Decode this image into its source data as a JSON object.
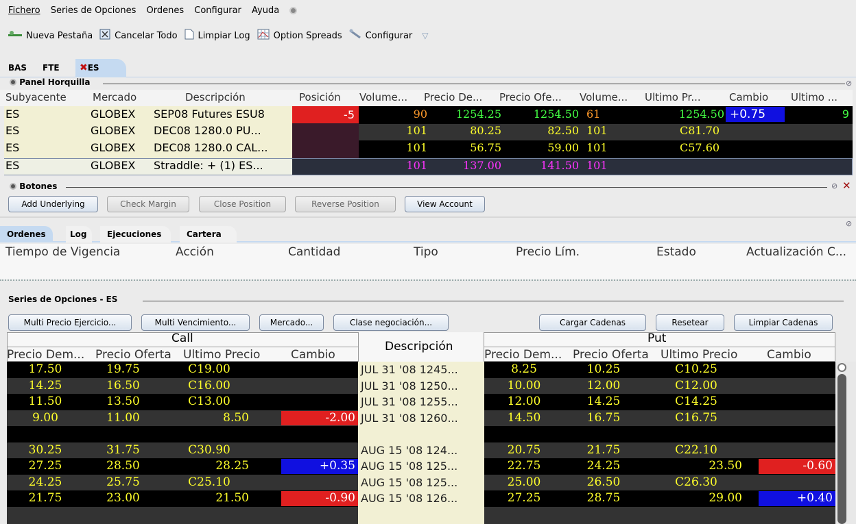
{
  "menu": [
    "Fichero",
    "Series de Opciones",
    "Ordenes",
    "Configurar",
    "Ayuda"
  ],
  "toolbar": {
    "new_tab": "Nueva Pestaña",
    "cancel_all": "Cancelar Todo",
    "clear_log": "Limpiar Log",
    "option_spreads": "Option Spreads",
    "configure": "Configurar"
  },
  "top_tabs": [
    "BAS",
    "FTE",
    "ES"
  ],
  "panel": {
    "title": "Panel Horquilla",
    "headers": [
      "Subyacente",
      "Mercado",
      "Descripción",
      "Posición",
      "Volume...",
      "Precio De...",
      "Precio Ofe...",
      "Volume...",
      "Ultimo Pr...",
      "Cambio",
      "Ultimo ..."
    ],
    "rows": [
      {
        "sym": "ES",
        "mkt": "GLOBEX",
        "desc": "SEP08 Futures ESU8",
        "pos": "-5",
        "vol1": "90",
        "bid": "1254.25",
        "ask": "1254.50",
        "vol2": "61",
        "last": "1254.50",
        "chg": "+0.75",
        "last2": "9"
      },
      {
        "sym": "ES",
        "mkt": "GLOBEX",
        "desc": "DEC08 1280.0 PU...",
        "pos": "",
        "vol1": "101",
        "bid": "80.25",
        "ask": "82.50",
        "vol2": "101",
        "last": "C81.70",
        "chg": "",
        "last2": ""
      },
      {
        "sym": "ES",
        "mkt": "GLOBEX",
        "desc": "DEC08 1280.0 CAL...",
        "pos": "",
        "vol1": "101",
        "bid": "56.75",
        "ask": "59.00",
        "vol2": "101",
        "last": "C57.60",
        "chg": "",
        "last2": ""
      },
      {
        "sym": "ES",
        "mkt": "GLOBEX",
        "desc": "Straddle: + (1) ES...",
        "pos": "",
        "vol1": "101",
        "bid": "137.00",
        "ask": "141.50",
        "vol2": "101",
        "last": "",
        "chg": "",
        "last2": ""
      }
    ]
  },
  "buttons": {
    "title": "Botones",
    "labels": [
      "Add Underlying",
      "Check Margin",
      "Close Position",
      "Reverse Position",
      "View Account"
    ]
  },
  "order_tabs": [
    "Ordenes",
    "Log",
    "Ejecuciones",
    "Cartera"
  ],
  "order_headers": [
    "Tiempo de Vigencia",
    "Acción",
    "Cantidad",
    "Tipo",
    "Precio Lím.",
    "Estado",
    "Actualización C..."
  ],
  "chain": {
    "title": "Series de Opciones - ES",
    "buttons": [
      "Multi Precio Ejercicio...",
      "Multi Vencimiento...",
      "Mercado...",
      "Clase negociación...",
      "Cargar Cadenas",
      "Resetear",
      "Limpiar Cadenas"
    ],
    "call_label": "Call",
    "put_label": "Put",
    "desc_label": "Descripción",
    "side_headers": [
      "Precio Dem...",
      "Precio Oferta",
      "Ultimo Precio",
      "Cambio"
    ],
    "rows": [
      {
        "c": [
          "17.50",
          "19.75",
          "C19.00",
          ""
        ],
        "d": "JUL 31 '08 1245...",
        "p": [
          "8.25",
          "10.25",
          "C10.25",
          ""
        ]
      },
      {
        "c": [
          "14.25",
          "16.50",
          "C16.00",
          ""
        ],
        "d": "JUL 31 '08 1250...",
        "p": [
          "10.00",
          "12.00",
          "C12.00",
          ""
        ]
      },
      {
        "c": [
          "11.50",
          "13.50",
          "C13.00",
          ""
        ],
        "d": "JUL 31 '08 1255...",
        "p": [
          "12.00",
          "14.25",
          "C14.25",
          ""
        ]
      },
      {
        "c": [
          "9.00",
          "11.00",
          "8.50",
          "-2.00"
        ],
        "d": "JUL 31 '08 1260...",
        "p": [
          "14.50",
          "16.75",
          "C16.75",
          ""
        ]
      },
      {
        "c": [
          "",
          "",
          "",
          ""
        ],
        "d": "",
        "p": [
          "",
          "",
          "",
          ""
        ]
      },
      {
        "c": [
          "30.25",
          "31.75",
          "C30.90",
          ""
        ],
        "d": "AUG 15 '08 124...",
        "p": [
          "20.75",
          "21.75",
          "C22.10",
          ""
        ]
      },
      {
        "c": [
          "27.25",
          "28.50",
          "28.25",
          "+0.35"
        ],
        "d": "AUG 15 '08 125...",
        "p": [
          "22.75",
          "24.25",
          "23.50",
          "-0.60"
        ]
      },
      {
        "c": [
          "24.25",
          "25.75",
          "C25.10",
          ""
        ],
        "d": "AUG 15 '08 125...",
        "p": [
          "25.00",
          "26.50",
          "C26.30",
          ""
        ]
      },
      {
        "c": [
          "21.75",
          "23.00",
          "21.50",
          "-0.90"
        ],
        "d": "AUG 15 '08 126...",
        "p": [
          "27.25",
          "28.75",
          "29.00",
          "+0.40"
        ]
      }
    ]
  },
  "colors": {
    "pos_neg": "#e02020",
    "chg_pos": "#1010e0",
    "row_a": "#000000",
    "row_b": "#333333",
    "desc_bg": "#f2f0d4"
  }
}
